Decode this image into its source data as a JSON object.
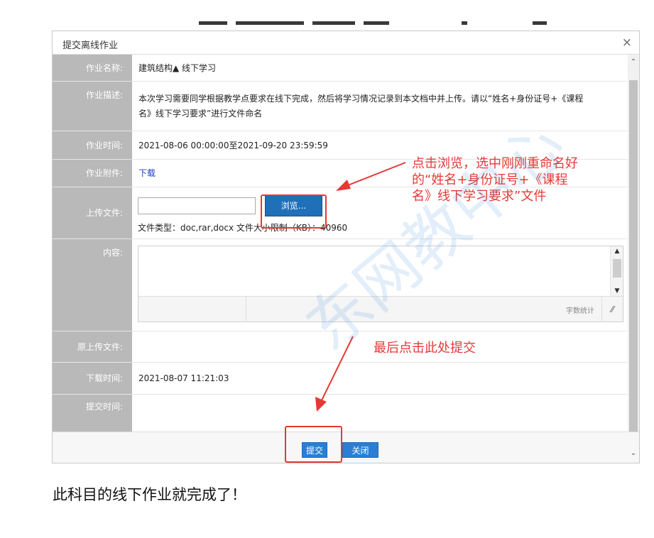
{
  "dialog": {
    "title": "提交离线作业",
    "close_icon": "×"
  },
  "form": {
    "name_label": "作业名称:",
    "name_value": "建筑结构▲ 线下学习",
    "desc_label": "作业描述:",
    "desc_value_line1": "本次学习需要同学根据教学点要求在线下完成，然后将学习情况记录到本文档中并上传。请以“姓名+身份证号+《课程",
    "desc_value_line2": "名》线下学习要求”进行文件命名",
    "time_label": "作业时间:",
    "time_value": "2021-08-06 00:00:00至2021-09-20 23:59:59",
    "attach_label": "作业附件:",
    "attach_link": "下载",
    "upload_label": "上传文件:",
    "browse_label": "浏览...",
    "file_info": "文件类型：doc,rar,docx  文件大小限制（KB）：40960",
    "content_label": "内容:",
    "word_count_label": "字数统计",
    "orig_label": "原上传文件:",
    "orig_value": "",
    "download_time_label": "下载时间:",
    "download_time_value": "2021-08-07 11:21:03",
    "submit_time_label": "提交时间:",
    "submit_time_value": ""
  },
  "footer": {
    "submit_label": "提交",
    "close_label": "关闭"
  },
  "annotations": {
    "browse_note_line1": "点击浏览，选中刚刚重命名好",
    "browse_note_line2": "的“姓名+身份证号+《课程",
    "browse_note_line3": "名》线下学习要求”文件",
    "submit_note": "最后点击此处提交",
    "color": "#e53935"
  },
  "caption": "此科目的线下作业就完成了！",
  "watermark": "东网教中心",
  "colors": {
    "label_bg": "#b9b9b9",
    "button_blue": "#2a7fd4",
    "browse_blue": "#1f6fb9"
  }
}
